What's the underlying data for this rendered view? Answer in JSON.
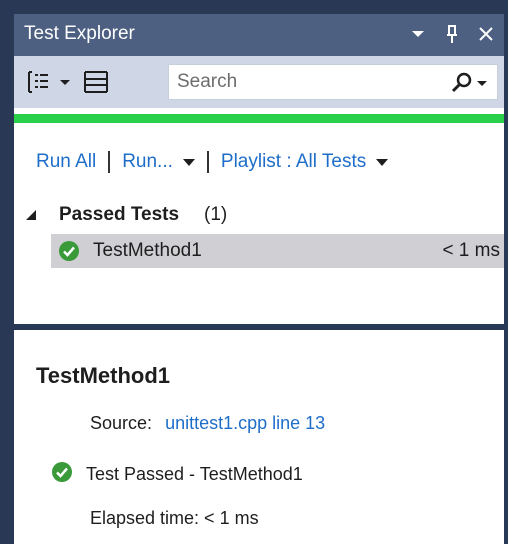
{
  "window": {
    "title": "Test Explorer"
  },
  "toolbar": {
    "search_placeholder": "Search",
    "group_by_icon": "group-by-icon",
    "playlist_icon": "playlist-icon",
    "search_icon": "search-icon"
  },
  "progress": {
    "fraction": 1.0,
    "color": "#2ad04a"
  },
  "actions": {
    "run_all": "Run All",
    "run": "Run...",
    "playlist": "Playlist : All Tests"
  },
  "groups": [
    {
      "name": "Passed Tests",
      "count": "(1)",
      "tests": [
        {
          "name": "TestMethod1",
          "duration": "< 1 ms",
          "status_icon": "check-circle-icon"
        }
      ]
    }
  ],
  "details": {
    "title": "TestMethod1",
    "source_label": "Source:",
    "source_link": "unittest1.cpp line 13",
    "status_text": "Test Passed - TestMethod1",
    "elapsed": "Elapsed time: < 1 ms"
  },
  "colors": {
    "frame": "#293955",
    "titlebar": "#4d6082",
    "toolbar": "#cfd6e5",
    "link": "#1e6ec9",
    "pass": "#3a9a3a",
    "selected_row": "#cfcfd4"
  }
}
